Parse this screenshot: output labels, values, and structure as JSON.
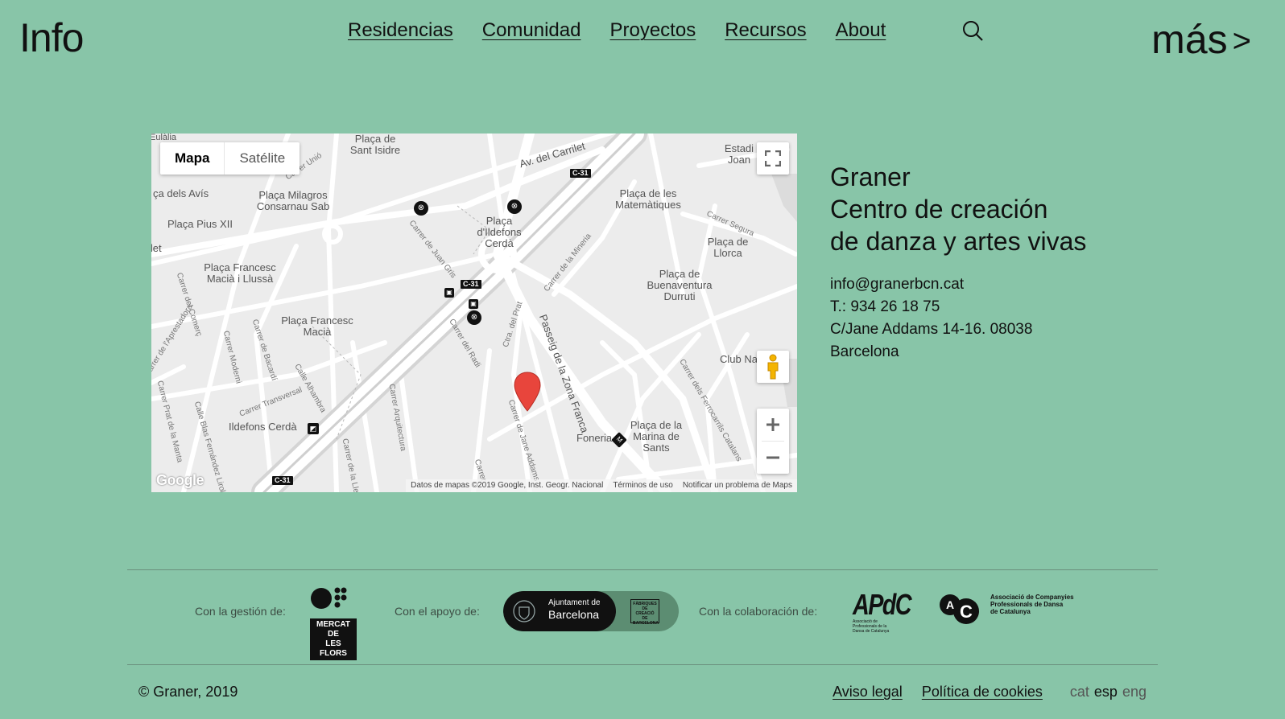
{
  "header": {
    "logo": "Info",
    "nav": [
      "Residencias",
      "Comunidad",
      "Proyectos",
      "Recursos",
      "About"
    ],
    "more_label": "más",
    "more_arrow": ">"
  },
  "map": {
    "type_controls": {
      "map": "Mapa",
      "satellite": "Satélite"
    },
    "places": [
      "Plaça de Sant Isidre",
      "Av. del Carrilet",
      "Estadi Joan",
      "ça dels Avís",
      "Plaça Milagros Consarnau Sab",
      "Plaça Pius XII",
      "Plaça d'Ildefons Cerdà",
      "Plaça de les Matemàtiques",
      "Plaça de Llorca",
      "Plaça Francesc Macià i Llussà",
      "Plaça de Buenaventura Durruti",
      "Plaça Francesc Macià",
      "Club Na",
      "Ildefons Cerdà",
      "Foneria",
      "Plaça de la Marina de Sants",
      "Eulàlia",
      "llet"
    ],
    "streets": [
      "Carrer Unió",
      "Carrer de Juan Gris",
      "Carrer de la Mineria",
      "Passeig de la Zona Franca",
      "Carrer de Jane Addams",
      "Carrer del Radi",
      "Ctra. del Prat",
      "Carrer del Comerç",
      "Carrer de l'Aprestadora",
      "Carrer Moderni",
      "Carrer de Bacardí",
      "Calle Alhambra",
      "Carrer Transversal",
      "Carrer Arquitectura",
      "Carrer Prat de la Manta",
      "Calle Blas Fernández Lirola",
      "Carrer de la Lle",
      "Carrer Segura",
      "Carrer dels Ferrocarrils Catalans",
      "Carrer"
    ],
    "highway": "C-31",
    "attribution": {
      "data": "Datos de mapas ©2019 Google, Inst. Geogr. Nacional",
      "terms": "Términos de uso",
      "report": "Notificar un problema de Maps"
    },
    "google": "Google"
  },
  "contact": {
    "title_lines": [
      "Graner",
      "Centro de creación",
      "de danza y artes vivas"
    ],
    "email": "info@granerbcn.cat",
    "phone": "T.: 934 26 18 75",
    "address": "C/Jane Addams 14-16. 08038",
    "city": "Barcelona"
  },
  "partners": {
    "managed_label": "Con la gestión de:",
    "support_label": "Con el apoyo de:",
    "collab_label": "Con la colaboración de:",
    "mdf_lines": [
      "MERCAT DE",
      "LES FLORS"
    ],
    "ajb_lines": [
      "Ajuntament de",
      "Barcelona"
    ],
    "fabriques_lines": [
      "FÀBRIQUES",
      "DE CREACIÓ",
      "DE BARCELONA"
    ],
    "apdc": "APdC",
    "apdc_sub": "Associació de Professionals de la Dansa de Catalunya",
    "adc_lines": [
      "Associació de Companyies",
      "Professionals de Dansa",
      "de Catalunya"
    ]
  },
  "footer": {
    "copyright": "© Graner, 2019",
    "legal": "Aviso legal",
    "cookies": "Política de cookies",
    "langs": [
      "cat",
      "esp",
      "eng"
    ],
    "current_lang": "esp"
  },
  "colors": {
    "background": "#88c5a8",
    "marker": "#e8453c",
    "map_base": "#ececec"
  }
}
